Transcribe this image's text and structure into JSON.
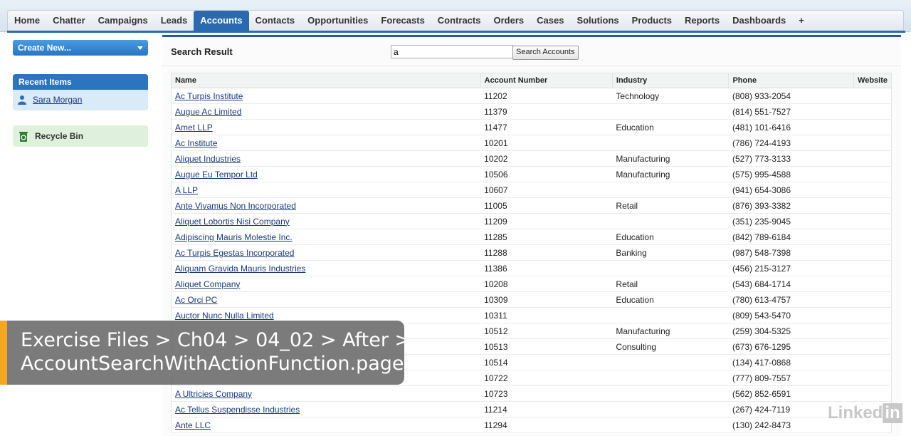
{
  "tabs": [
    {
      "label": "Home"
    },
    {
      "label": "Chatter"
    },
    {
      "label": "Campaigns"
    },
    {
      "label": "Leads"
    },
    {
      "label": "Accounts",
      "active": true
    },
    {
      "label": "Contacts"
    },
    {
      "label": "Opportunities"
    },
    {
      "label": "Forecasts"
    },
    {
      "label": "Contracts"
    },
    {
      "label": "Orders"
    },
    {
      "label": "Cases"
    },
    {
      "label": "Solutions"
    },
    {
      "label": "Products"
    },
    {
      "label": "Reports"
    },
    {
      "label": "Dashboards"
    },
    {
      "label": "+"
    }
  ],
  "sidebar": {
    "create_new": "Create New...",
    "recent_items_title": "Recent Items",
    "recent_items": [
      {
        "label": "Sara Morgan"
      }
    ],
    "recycle_bin": "Recycle Bin"
  },
  "search": {
    "title": "Search Result",
    "query": "a",
    "button": "Search Accounts"
  },
  "table": {
    "headers": [
      "Name",
      "Account Number",
      "Industry",
      "Phone",
      "Website"
    ],
    "rows": [
      [
        "Ac Turpis Institute",
        "11202",
        "Technology",
        "(808) 933-2054",
        ""
      ],
      [
        "Augue Ac Limited",
        "11379",
        "",
        "(814) 551-7527",
        ""
      ],
      [
        "Amet LLP",
        "11477",
        "Education",
        "(481) 101-6416",
        ""
      ],
      [
        "Ac Institute",
        "10201",
        "",
        "(786) 724-4193",
        ""
      ],
      [
        "Aliquet Industries",
        "10202",
        "Manufacturing",
        "(527) 773-3133",
        ""
      ],
      [
        "Augue Eu Tempor Ltd",
        "10506",
        "Manufacturing",
        "(575) 995-4588",
        ""
      ],
      [
        "A LLP",
        "10607",
        "",
        "(941) 654-3086",
        ""
      ],
      [
        "Ante Vivamus Non Incorporated",
        "11005",
        "Retail",
        "(876) 393-3382",
        ""
      ],
      [
        "Aliquet Lobortis Nisi Company",
        "11209",
        "",
        "(351) 235-9045",
        ""
      ],
      [
        "Adipiscing Mauris Molestie Inc.",
        "11285",
        "Education",
        "(842) 789-6184",
        ""
      ],
      [
        "Ac Turpis Egestas Incorporated",
        "11288",
        "Banking",
        "(987) 548-7398",
        ""
      ],
      [
        "Aliquam Gravida Mauris Industries",
        "11386",
        "",
        "(456) 215-3127",
        ""
      ],
      [
        "Aliquet Company",
        "10208",
        "Retail",
        "(543) 684-1714",
        ""
      ],
      [
        "Ac Orci PC",
        "10309",
        "Education",
        "(780) 613-4757",
        ""
      ],
      [
        "Auctor Nunc Nulla Limited",
        "10311",
        "",
        "(809) 543-5470",
        ""
      ],
      [
        "",
        "10512",
        "Manufacturing",
        "(259) 304-5325",
        ""
      ],
      [
        "",
        "10513",
        "Consulting",
        "(673) 676-1295",
        ""
      ],
      [
        "",
        "10514",
        "",
        "(134) 417-0868",
        ""
      ],
      [
        "",
        "10722",
        "",
        "(777) 809-7557",
        ""
      ],
      [
        "A Ultricies Company",
        "10723",
        "",
        "(562) 852-6591",
        ""
      ],
      [
        "Ac Tellus Suspendisse Industries",
        "11214",
        "",
        "(267) 424-7119",
        ""
      ],
      [
        "Ante LLC",
        "11294",
        "",
        "(130) 242-8473",
        ""
      ]
    ]
  },
  "overlay": {
    "line1": "Exercise Files > Ch04 > 04_02 > After >",
    "line2": "AccountSearchWithActionFunction.page"
  },
  "watermark": {
    "text": "Linked",
    "badge": "in"
  },
  "colors": {
    "accent": "#2a6ab0",
    "caption_bar": "#f5a623",
    "recycle_bg": "#dff1dc"
  }
}
